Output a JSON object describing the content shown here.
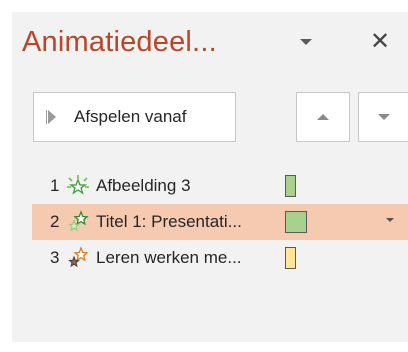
{
  "pane": {
    "title": "Animatiedeel...",
    "play_button_label": "Afspelen vanaf"
  },
  "colors": {
    "title": "#b7472a",
    "selection": "#f6c9b1",
    "timing_green": "#a9d18e",
    "timing_yellow": "#ffe699"
  },
  "icons": {
    "title_menu": "chevron-down-icon",
    "close": "close-icon",
    "play": "play-icon",
    "move_up": "move-up-icon",
    "move_down": "move-down-icon"
  },
  "animations": [
    {
      "number": "1",
      "label": "Afbeelding 3",
      "effect": "entrance-star-icon",
      "timing_color": "#a9d18e",
      "selected": false
    },
    {
      "number": "2",
      "label": "Titel 1: Presentati...",
      "effect": "entrance-star-icon",
      "timing_color": "#a9d18e",
      "selected": true
    },
    {
      "number": "3",
      "label": "Leren werken me...",
      "effect": "emphasis-star-icon",
      "timing_color": "#ffe699",
      "selected": false
    }
  ]
}
